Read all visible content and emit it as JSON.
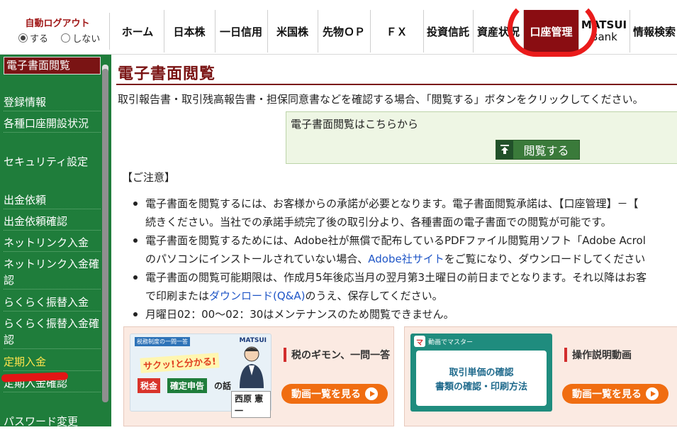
{
  "autologout": {
    "title": "自動ログアウト",
    "on_label": "する",
    "off_label": "しない",
    "selected": "する"
  },
  "nav": {
    "tabs": [
      {
        "label": "ホーム"
      },
      {
        "label": "日本株"
      },
      {
        "label": "一日信用"
      },
      {
        "label": "米国株"
      },
      {
        "label": "先物ＯＰ"
      },
      {
        "label": "ＦＸ"
      },
      {
        "label": "投資信託"
      },
      {
        "label": "資産状況"
      },
      {
        "label": "口座管理"
      },
      {
        "label": "MATSUI",
        "sub": "Bank"
      },
      {
        "label": "情報検索"
      }
    ],
    "active": "口座管理"
  },
  "sidebar": {
    "items": [
      {
        "label": "電子書面閲覧"
      },
      {
        "label": "登録情報"
      },
      {
        "label": "各種口座開設状況"
      },
      {
        "label": "セキュリティ設定"
      },
      {
        "label": "出金依頼"
      },
      {
        "label": "出金依頼確認"
      },
      {
        "label": "ネットリンク入金"
      },
      {
        "label": "ネットリンク入金確認"
      },
      {
        "label": "らくらく振替入金"
      },
      {
        "label": "らくらく振替入金確認"
      },
      {
        "label": "定期入金"
      },
      {
        "label": "定期入金確認"
      },
      {
        "label": "パスワード変更"
      }
    ]
  },
  "main": {
    "title": "電子書面閲覧",
    "intro": "取引報告書・取引残高報告書・担保同意書などを確認する場合、「閲覧する」ボタンをクリックしてください。",
    "view_box": {
      "text": "電子書面閲覧はこちらから",
      "button": "閲覧する"
    },
    "notes_title": "【ご注意】",
    "notes": [
      {
        "line1": "電子書面を閲覧するには、お客様からの承諾が必要となります。電子書面閲覧承諾は、【口座管理】－【",
        "line2": "続きください。当社での承諾手続完了後の取引分より、各種書面の電子書面での閲覧が可能です。"
      },
      {
        "line1": "電子書面を閲覧するためには、Adobe社が無償で配布しているPDFファイル閲覧用ソフト「Adobe Acrol",
        "line2a": "のパソコンにインストールされていない場合、",
        "line2_link": "Adobe社サイト",
        "line2b": "をご覧になり、ダウンロードしてください"
      },
      {
        "line1": "電子書面の閲覧可能期限は、作成月5年後応当月の翌月第3土曜日の前日までとなります。それ以降はお客",
        "line2a": "で印刷または",
        "line2_link": "ダウンロード(Q&A)",
        "line2b": "のうえ、保存してください。"
      },
      {
        "line1": "月曜日02：00～02：30はメンテナンスのため閲覧できません。"
      }
    ]
  },
  "cards": [
    {
      "title": "税のギモン、一問一答",
      "button": "動画一覧を見る",
      "thumb": {
        "badge": "税務制度の一問一答",
        "brand": "MATSUI",
        "catch": "サクッ!と分かる!",
        "tag1": "税金",
        "tag2": "確定申告",
        "tag3": "の話",
        "name": "西原 憲一"
      }
    },
    {
      "title": "操作説明動画",
      "button": "動画一覧を見る",
      "thumb": {
        "mark": "マ",
        "top": "動画でマスター",
        "line1": "取引単価の確認",
        "line2": "書類の確認・印刷方法"
      }
    }
  ],
  "colors": {
    "brand_green": "#1f7d3b",
    "active_red": "#8a0d12",
    "title_red": "#7a1414",
    "annotation_red": "#ea1b1b",
    "video_orange": "#f06d11"
  }
}
